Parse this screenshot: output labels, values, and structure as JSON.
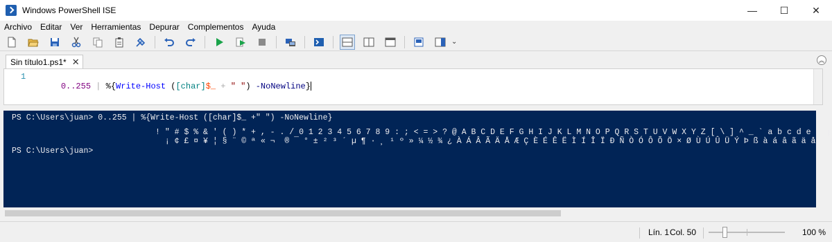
{
  "window": {
    "title": "Windows PowerShell ISE",
    "minimize_glyph": "—",
    "maximize_glyph": "☐",
    "close_glyph": "✕"
  },
  "menu": [
    "Archivo",
    "Editar",
    "Ver",
    "Herramientas",
    "Depurar",
    "Complementos",
    "Ayuda"
  ],
  "toolbar": {
    "icons": [
      "new-script-icon",
      "open-icon",
      "save-icon",
      "cut-icon",
      "copy-icon",
      "paste-icon",
      "clear-console-icon",
      "undo-icon",
      "redo-icon",
      "run-script-icon",
      "run-selection-icon",
      "stop-icon",
      "remote-powershell-tab-icon",
      "start-powershell-exe-icon",
      "show-script-pane-top-icon",
      "show-script-pane-right-icon",
      "show-script-pane-maximized-icon",
      "show-commands-window-icon",
      "show-command-addon-icon"
    ],
    "accent": "#1f5fb0",
    "overflow_glyph": "⌄"
  },
  "editor": {
    "tab_title": "Sin título1.ps1*",
    "tab_close_glyph": "✕",
    "collapse_glyph": "︽",
    "line_number": "1",
    "code_tokens": [
      {
        "text": "0..255",
        "kind": "number"
      },
      {
        "text": " | ",
        "kind": "operator"
      },
      {
        "text": "%{",
        "kind": "plain"
      },
      {
        "text": "Write-Host",
        "kind": "cmd"
      },
      {
        "text": " (",
        "kind": "plain"
      },
      {
        "text": "[char]",
        "kind": "type"
      },
      {
        "text": "$_",
        "kind": "var"
      },
      {
        "text": " + ",
        "kind": "operator"
      },
      {
        "text": "\" \"",
        "kind": "string"
      },
      {
        "text": ") ",
        "kind": "plain"
      },
      {
        "text": "-NoNewline",
        "kind": "param"
      },
      {
        "text": "}",
        "kind": "plain"
      }
    ]
  },
  "console": {
    "background": "#012456",
    "lines": [
      "PS C:\\Users\\juan> 0..255 | %{Write-Host ([char]$_ +\" \") -NoNewline}",
      "                              ! \" # $ % & ' ( ) * + , - . / 0 1 2 3 4 5 6 7 8 9 : ; < = > ? @ A B C D E F G H I J K L M N O P Q R S T U V W X Y Z [ \\ ] ^ _ ` a b c d e f g h i",
      "                                ¡ ¢ £ ¤ ¥ ¦ § ¨ © ª « ¬ ­ ® ¯ ° ± ² ³ ´ µ ¶ · ¸ ¹ º » ¼ ½ ¾ ¿ À Á Â Ã Ä Å Æ Ç È É Ê Ë Ì Í Î Ï Ð Ñ Ò Ó Ô Õ Ö × Ø Ù Ú Û Ü Ý Þ ß à á â ã ä å æ ç è",
      "PS C:\\Users\\juan>"
    ]
  },
  "status": {
    "line": "Lín. 1",
    "col": "Col. 50",
    "zoom": "100 %",
    "zoom_value": 100
  }
}
